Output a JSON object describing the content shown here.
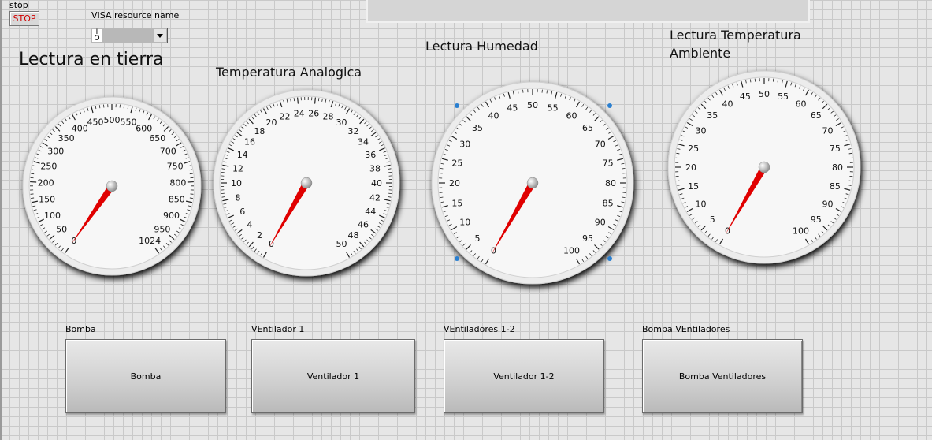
{
  "stop_control": {
    "label": "stop",
    "button_text": "STOP"
  },
  "visa": {
    "label": "VISA resource name",
    "icon_text": "I/O",
    "value": ""
  },
  "main_title": "Lectura en tierra",
  "gauges": [
    {
      "name": "lectura-en-tierra",
      "title": "",
      "min": 0,
      "max": 1024,
      "value": 0,
      "ticks": [
        "0",
        "50",
        "100",
        "150",
        "200",
        "250",
        "300",
        "350",
        "400",
        "450",
        "500",
        "550",
        "600",
        "650",
        "700",
        "750",
        "800",
        "850",
        "900",
        "950",
        "1024"
      ]
    },
    {
      "name": "temperatura-analogica",
      "title": "Temperatura Analogica",
      "min": 0,
      "max": 50,
      "value": 0,
      "ticks": [
        "0",
        "2",
        "4",
        "6",
        "8",
        "10",
        "12",
        "14",
        "16",
        "18",
        "20",
        "22",
        "24",
        "26",
        "28",
        "30",
        "32",
        "34",
        "36",
        "38",
        "40",
        "42",
        "44",
        "46",
        "48",
        "50"
      ]
    },
    {
      "name": "lectura-humedad",
      "title": "Lectura Humedad",
      "min": 0,
      "max": 100,
      "value": 0,
      "ticks": [
        "0",
        "5",
        "10",
        "15",
        "20",
        "25",
        "30",
        "35",
        "40",
        "45",
        "50",
        "55",
        "60",
        "65",
        "70",
        "75",
        "80",
        "85",
        "90",
        "95",
        "100"
      ]
    },
    {
      "name": "lectura-temperatura-ambiente",
      "title_line1": "Lectura Temperatura",
      "title_line2": "Ambiente",
      "min": 0,
      "max": 100,
      "value": 0,
      "ticks": [
        "0",
        "5",
        "10",
        "15",
        "20",
        "25",
        "30",
        "35",
        "40",
        "45",
        "50",
        "55",
        "60",
        "65",
        "70",
        "75",
        "80",
        "85",
        "90",
        "95",
        "100"
      ]
    }
  ],
  "buttons": [
    {
      "label": "Bomba",
      "text": "Bomba"
    },
    {
      "label": "VEntilador 1",
      "text": "Ventilador 1"
    },
    {
      "label": "VEntiladores 1-2",
      "text": "Ventilador 1-2"
    },
    {
      "label": "Bomba VEntiladores",
      "text": "Bomba Ventiladores"
    }
  ],
  "colors": {
    "needle": "#e00000",
    "stop_text": "#d00000",
    "selection_handle": "#2a7fd0",
    "dial_face": "#f7f7f7"
  }
}
